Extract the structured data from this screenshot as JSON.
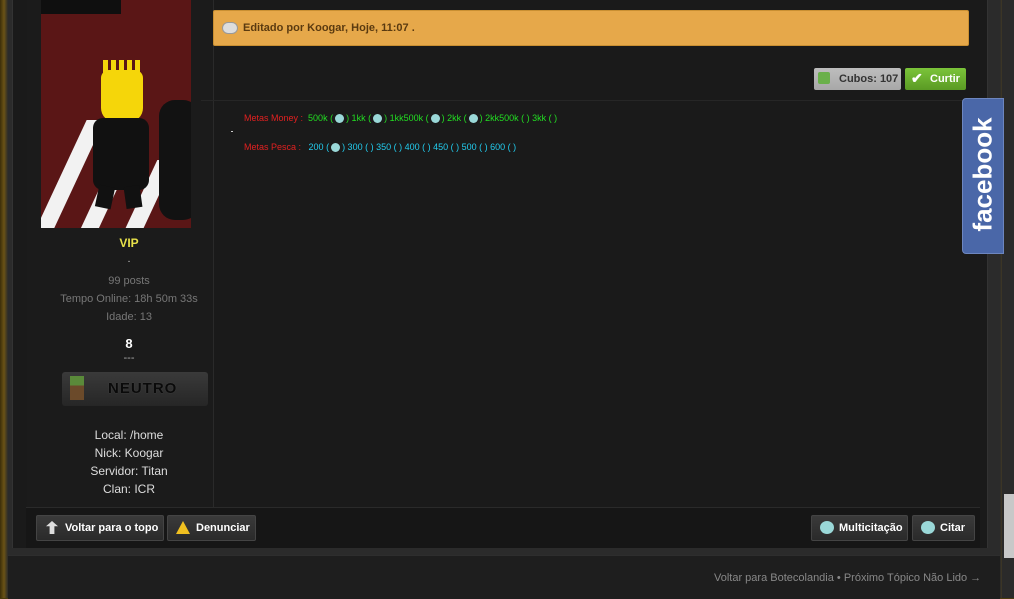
{
  "edit_notice": {
    "text": "Editado por Koogar, Hoje, 11:07 ."
  },
  "user": {
    "rank": "VIP",
    "dot": ".",
    "posts": "99 posts",
    "online_time": "Tempo Online: 18h 50m 33s",
    "age": "Idade: 13",
    "reputation": "8",
    "dashes": "---",
    "badge": "NEUTRO",
    "local": "Local: /home",
    "nick": "Nick: Koogar",
    "server": "Servidor: Titan",
    "clan": "Clan: ICR"
  },
  "reactions": {
    "cubos_label": "Cubos: 107",
    "curtir_label": "Curtir"
  },
  "post_content": {
    "money_label": "Metas Money :",
    "money_values": [
      "500k (",
      ") 1kk (",
      ") 1kk500k (",
      ") 2kk (",
      ") 2kk500k (  ) 3kk (  )"
    ],
    "pesca_label": "Metas Pesca :",
    "pesca_values": [
      "200   (",
      ")  300  (   )  350  (  ) 400 (   ) 450 (   )   500   (   ) 600 (  )"
    ]
  },
  "footer_buttons": {
    "back_to_top": "Voltar para o topo",
    "report": "Denunciar",
    "multiquote": "Multicitação",
    "quote": "Citar"
  },
  "bottom_nav": {
    "text": "Voltar para Botecolandia • Próximo Tópico Não Lido →"
  },
  "facebook_tab": {
    "label": "facebook"
  },
  "colors": {
    "accent_green": "#5a9a24",
    "edit_bg": "#e6a84a",
    "facebook": "#4a67a8"
  }
}
